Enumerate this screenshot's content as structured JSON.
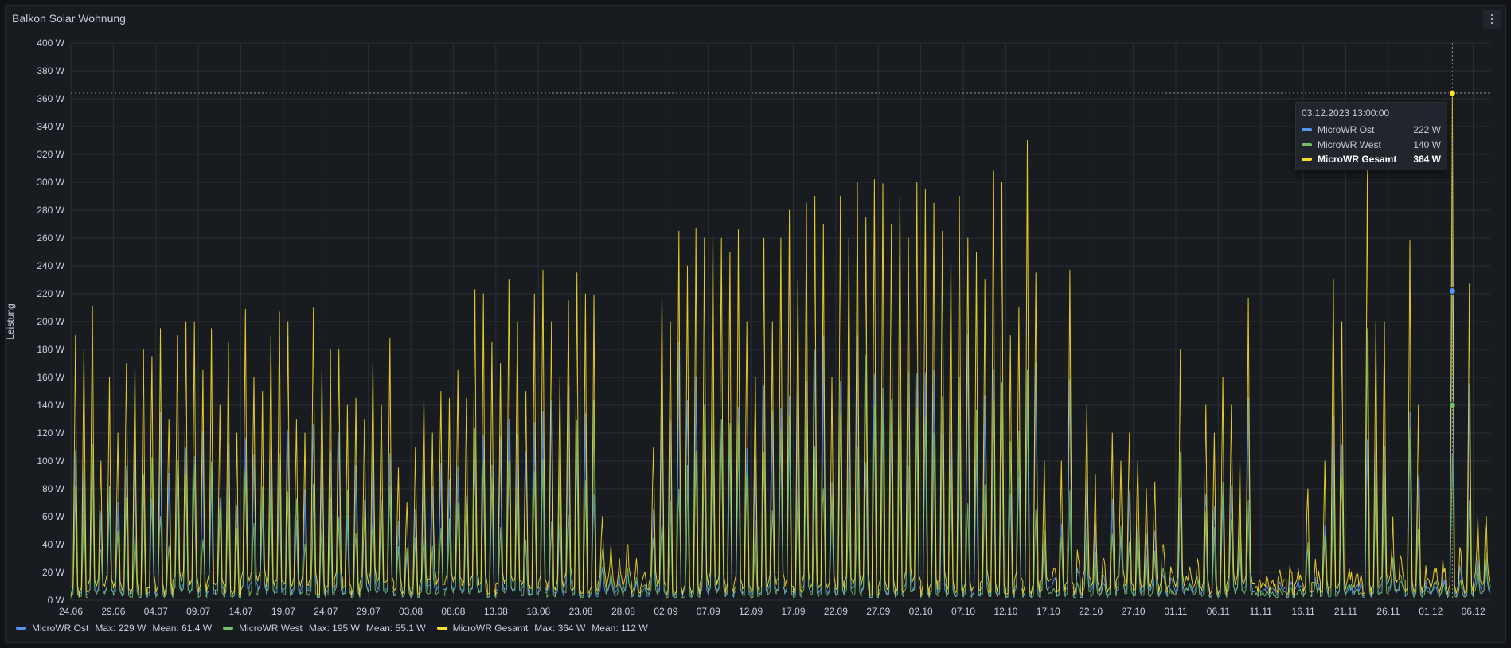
{
  "panel": {
    "title": "Balkon Solar Wohnung",
    "menu_icon": "vertical-dots-icon"
  },
  "colors": {
    "ost": "#5794f2",
    "west": "#73bf69",
    "gesamt": "#fade2a",
    "grid": "#2c2f35",
    "text": "#ccccdc"
  },
  "chart_data": {
    "type": "line",
    "title": "Balkon Solar Wohnung",
    "ylabel": "Leistung",
    "xlabel": "",
    "ylim": [
      0,
      400
    ],
    "y_unit": "W",
    "y_ticks": [
      "0 W",
      "20 W",
      "40 W",
      "60 W",
      "80 W",
      "100 W",
      "120 W",
      "140 W",
      "160 W",
      "180 W",
      "200 W",
      "220 W",
      "240 W",
      "260 W",
      "280 W",
      "300 W",
      "320 W",
      "340 W",
      "360 W",
      "380 W",
      "400 W"
    ],
    "x_range": [
      "2023-06-24",
      "2023-12-08"
    ],
    "x_ticks": [
      "24.06",
      "29.06",
      "04.07",
      "09.07",
      "14.07",
      "19.07",
      "24.07",
      "29.07",
      "03.08",
      "08.08",
      "13.08",
      "18.08",
      "23.08",
      "28.08",
      "02.09",
      "07.09",
      "12.09",
      "17.09",
      "22.09",
      "27.09",
      "02.10",
      "07.10",
      "12.10",
      "17.10",
      "22.10",
      "27.10",
      "01.11",
      "06.11",
      "11.11",
      "16.11",
      "21.11",
      "26.11",
      "01.12",
      "06.12"
    ],
    "legend_placement": "bottom-left",
    "grid": true,
    "daily_peak_gesamt": [
      [
        "2023-06-24",
        190
      ],
      [
        "2023-06-25",
        180
      ],
      [
        "2023-06-26",
        211
      ],
      [
        "2023-06-27",
        100
      ],
      [
        "2023-06-28",
        160
      ],
      [
        "2023-06-29",
        120
      ],
      [
        "2023-06-30",
        170
      ],
      [
        "2023-07-01",
        168
      ],
      [
        "2023-07-02",
        180
      ],
      [
        "2023-07-03",
        175
      ],
      [
        "2023-07-04",
        195
      ],
      [
        "2023-07-05",
        130
      ],
      [
        "2023-07-06",
        190
      ],
      [
        "2023-07-07",
        200
      ],
      [
        "2023-07-08",
        200
      ],
      [
        "2023-07-09",
        165
      ],
      [
        "2023-07-10",
        195
      ],
      [
        "2023-07-11",
        140
      ],
      [
        "2023-07-12",
        185
      ],
      [
        "2023-07-13",
        120
      ],
      [
        "2023-07-14",
        209
      ],
      [
        "2023-07-15",
        160
      ],
      [
        "2023-07-16",
        150
      ],
      [
        "2023-07-17",
        190
      ],
      [
        "2023-07-18",
        207
      ],
      [
        "2023-07-19",
        200
      ],
      [
        "2023-07-20",
        130
      ],
      [
        "2023-07-21",
        120
      ],
      [
        "2023-07-22",
        210
      ],
      [
        "2023-07-23",
        165
      ],
      [
        "2023-07-24",
        180
      ],
      [
        "2023-07-25",
        180
      ],
      [
        "2023-07-26",
        140
      ],
      [
        "2023-07-27",
        145
      ],
      [
        "2023-07-28",
        130
      ],
      [
        "2023-07-29",
        170
      ],
      [
        "2023-07-30",
        140
      ],
      [
        "2023-07-31",
        188
      ],
      [
        "2023-08-01",
        95
      ],
      [
        "2023-08-02",
        70
      ],
      [
        "2023-08-03",
        110
      ],
      [
        "2023-08-04",
        145
      ],
      [
        "2023-08-05",
        120
      ],
      [
        "2023-08-06",
        150
      ],
      [
        "2023-08-07",
        145
      ],
      [
        "2023-08-08",
        165
      ],
      [
        "2023-08-09",
        145
      ],
      [
        "2023-08-10",
        223
      ],
      [
        "2023-08-11",
        220
      ],
      [
        "2023-08-12",
        185
      ],
      [
        "2023-08-13",
        170
      ],
      [
        "2023-08-14",
        230
      ],
      [
        "2023-08-15",
        200
      ],
      [
        "2023-08-16",
        150
      ],
      [
        "2023-08-17",
        220
      ],
      [
        "2023-08-18",
        237
      ],
      [
        "2023-08-19",
        200
      ],
      [
        "2023-08-20",
        160
      ],
      [
        "2023-08-21",
        215
      ],
      [
        "2023-08-22",
        235
      ],
      [
        "2023-08-23",
        220
      ],
      [
        "2023-08-24",
        219
      ],
      [
        "2023-08-25",
        60
      ],
      [
        "2023-08-26",
        40
      ],
      [
        "2023-08-27",
        30
      ],
      [
        "2023-08-28",
        40
      ],
      [
        "2023-08-29",
        30
      ],
      [
        "2023-08-30",
        20
      ],
      [
        "2023-08-31",
        110
      ],
      [
        "2023-09-01",
        220
      ],
      [
        "2023-09-02",
        200
      ],
      [
        "2023-09-03",
        265
      ],
      [
        "2023-09-04",
        240
      ],
      [
        "2023-09-05",
        267
      ],
      [
        "2023-09-06",
        260
      ],
      [
        "2023-09-07",
        264
      ],
      [
        "2023-09-08",
        260
      ],
      [
        "2023-09-09",
        250
      ],
      [
        "2023-09-10",
        266
      ],
      [
        "2023-09-11",
        200
      ],
      [
        "2023-09-12",
        160
      ],
      [
        "2023-09-13",
        260
      ],
      [
        "2023-09-14",
        200
      ],
      [
        "2023-09-15",
        260
      ],
      [
        "2023-09-16",
        280
      ],
      [
        "2023-09-17",
        230
      ],
      [
        "2023-09-18",
        285
      ],
      [
        "2023-09-19",
        290
      ],
      [
        "2023-09-20",
        270
      ],
      [
        "2023-09-21",
        160
      ],
      [
        "2023-09-22",
        290
      ],
      [
        "2023-09-23",
        260
      ],
      [
        "2023-09-24",
        300
      ],
      [
        "2023-09-25",
        275
      ],
      [
        "2023-09-26",
        302
      ],
      [
        "2023-09-27",
        299
      ],
      [
        "2023-09-28",
        270
      ],
      [
        "2023-09-29",
        290
      ],
      [
        "2023-09-30",
        260
      ],
      [
        "2023-10-01",
        300
      ],
      [
        "2023-10-02",
        295
      ],
      [
        "2023-10-03",
        285
      ],
      [
        "2023-10-04",
        265
      ],
      [
        "2023-10-05",
        245
      ],
      [
        "2023-10-06",
        290
      ],
      [
        "2023-10-07",
        260
      ],
      [
        "2023-10-08",
        250
      ],
      [
        "2023-10-09",
        230
      ],
      [
        "2023-10-10",
        308
      ],
      [
        "2023-10-11",
        300
      ],
      [
        "2023-10-12",
        190
      ],
      [
        "2023-10-13",
        210
      ],
      [
        "2023-10-14",
        330
      ],
      [
        "2023-10-15",
        235
      ],
      [
        "2023-10-16",
        100
      ],
      [
        "2023-10-17",
        20
      ],
      [
        "2023-10-18",
        100
      ],
      [
        "2023-10-19",
        237
      ],
      [
        "2023-10-20",
        30
      ],
      [
        "2023-10-21",
        140
      ],
      [
        "2023-10-22",
        90
      ],
      [
        "2023-10-23",
        30
      ],
      [
        "2023-10-24",
        120
      ],
      [
        "2023-10-25",
        100
      ],
      [
        "2023-10-26",
        120
      ],
      [
        "2023-10-27",
        100
      ],
      [
        "2023-10-28",
        80
      ],
      [
        "2023-10-29",
        85
      ],
      [
        "2023-10-30",
        40
      ],
      [
        "2023-10-31",
        20
      ],
      [
        "2023-11-01",
        180
      ],
      [
        "2023-11-02",
        20
      ],
      [
        "2023-11-03",
        30
      ],
      [
        "2023-11-04",
        140
      ],
      [
        "2023-11-05",
        120
      ],
      [
        "2023-11-06",
        160
      ],
      [
        "2023-11-07",
        140
      ],
      [
        "2023-11-08",
        100
      ],
      [
        "2023-11-09",
        217
      ],
      [
        "2023-11-10",
        10
      ],
      [
        "2023-11-11",
        10
      ],
      [
        "2023-11-12",
        10
      ],
      [
        "2023-11-13",
        10
      ],
      [
        "2023-11-14",
        20
      ],
      [
        "2023-11-15",
        15
      ],
      [
        "2023-11-16",
        80
      ],
      [
        "2023-11-17",
        20
      ],
      [
        "2023-11-18",
        100
      ],
      [
        "2023-11-19",
        230
      ],
      [
        "2023-11-20",
        200
      ],
      [
        "2023-11-21",
        15
      ],
      [
        "2023-11-22",
        10
      ],
      [
        "2023-11-23",
        310
      ],
      [
        "2023-11-24",
        200
      ],
      [
        "2023-11-25",
        200
      ],
      [
        "2023-11-26",
        60
      ],
      [
        "2023-11-27",
        30
      ],
      [
        "2023-11-28",
        258
      ],
      [
        "2023-11-29",
        140
      ],
      [
        "2023-11-30",
        15
      ],
      [
        "2023-12-01",
        20
      ],
      [
        "2023-12-02",
        20
      ],
      [
        "2023-12-03",
        364
      ],
      [
        "2023-12-04",
        35
      ],
      [
        "2023-12-05",
        227
      ],
      [
        "2023-12-06",
        60
      ],
      [
        "2023-12-07",
        60
      ]
    ],
    "series": [
      {
        "name": "MicroWR Ost",
        "max": "Max: 229 W",
        "mean": "Mean: 61.4 W",
        "ratio": 0.55
      },
      {
        "name": "MicroWR West",
        "max": "Max: 195 W",
        "mean": "Mean: 55.1 W",
        "ratio": 0.45
      },
      {
        "name": "MicroWR Gesamt",
        "max": "Max: 364 W",
        "mean": "Mean: 112 W",
        "ratio": 1.0
      }
    ],
    "hover": {
      "x": "2023-12-03T13:00:00",
      "time_label": "03.12.2023 13:00:00",
      "values": [
        {
          "name": "MicroWR Ost",
          "value": 222,
          "label": "222 W"
        },
        {
          "name": "MicroWR West",
          "value": 140,
          "label": "140 W"
        },
        {
          "name": "MicroWR Gesamt",
          "value": 364,
          "label": "364 W"
        }
      ]
    }
  }
}
